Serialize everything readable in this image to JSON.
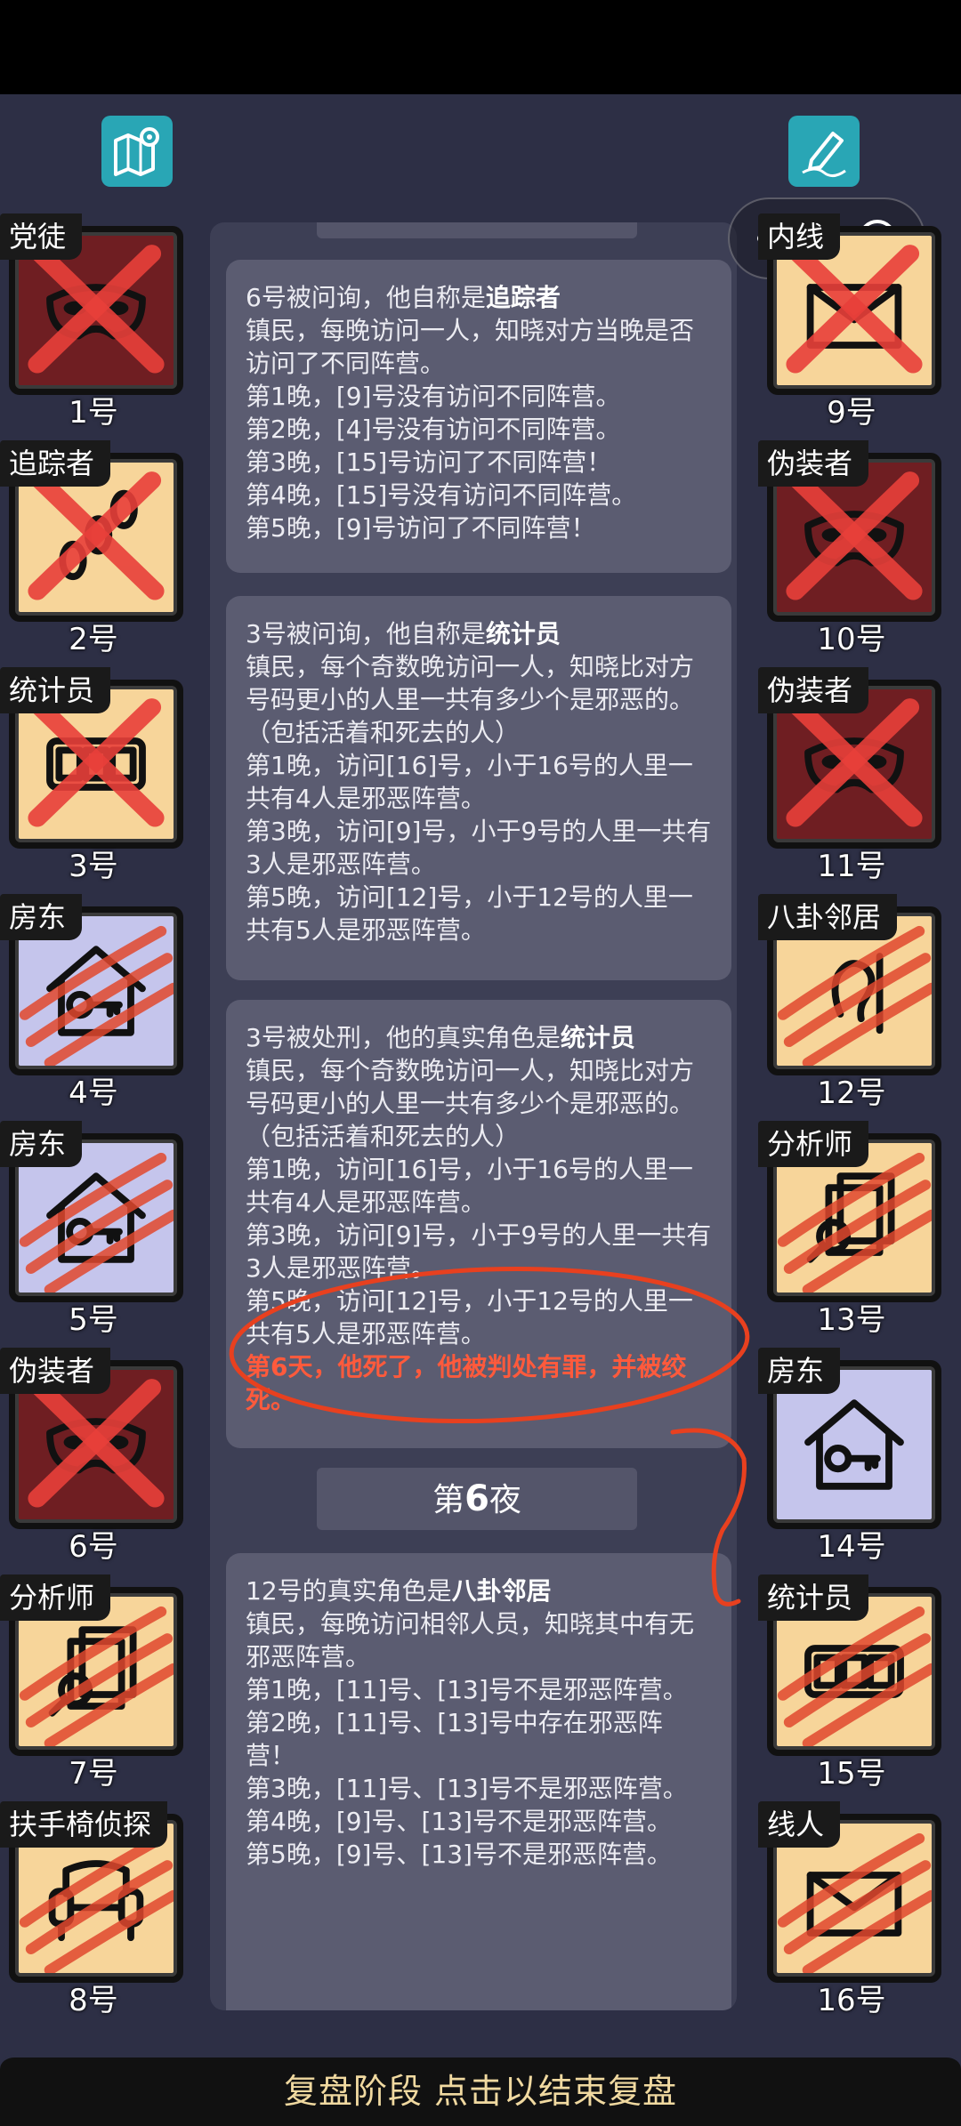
{
  "toolbar": {
    "map_icon": "map-pin-icon",
    "note_icon": "pen-note-icon"
  },
  "players_left": [
    {
      "role": "党徒",
      "seat": "1号",
      "bg": "evil",
      "mark": "x",
      "icon": "mask-icon"
    },
    {
      "role": "追踪者",
      "seat": "2号",
      "bg": "good",
      "mark": "x",
      "icon": "footprints-icon"
    },
    {
      "role": "统计员",
      "seat": "3号",
      "bg": "good",
      "mark": "x",
      "icon": "counter-icon"
    },
    {
      "role": "房东",
      "seat": "4号",
      "bg": "lav",
      "mark": "claw",
      "icon": "house-key-icon"
    },
    {
      "role": "房东",
      "seat": "5号",
      "bg": "lav",
      "mark": "claw",
      "icon": "house-key-icon"
    },
    {
      "role": "伪装者",
      "seat": "6号",
      "bg": "evil",
      "mark": "x",
      "icon": "mask-icon"
    },
    {
      "role": "分析师",
      "seat": "7号",
      "bg": "good",
      "mark": "claw",
      "icon": "files-magnifier-icon"
    },
    {
      "role": "扶手椅侦探",
      "seat": "8号",
      "bg": "good",
      "mark": "claw",
      "icon": "armchair-icon"
    }
  ],
  "players_right": [
    {
      "role": "内线",
      "seat": "9号",
      "bg": "good",
      "mark": "x",
      "icon": "envelope-icon"
    },
    {
      "role": "伪装者",
      "seat": "10号",
      "bg": "evil",
      "mark": "x",
      "icon": "mask-icon"
    },
    {
      "role": "伪装者",
      "seat": "11号",
      "bg": "evil",
      "mark": "x",
      "icon": "mask-icon"
    },
    {
      "role": "八卦邻居",
      "seat": "12号",
      "bg": "good",
      "mark": "claw",
      "icon": "ear-icon"
    },
    {
      "role": "分析师",
      "seat": "13号",
      "bg": "good",
      "mark": "claw",
      "icon": "files-magnifier-icon"
    },
    {
      "role": "房东",
      "seat": "14号",
      "bg": "lav",
      "mark": "none",
      "icon": "house-key-icon"
    },
    {
      "role": "统计员",
      "seat": "15号",
      "bg": "good",
      "mark": "claw",
      "icon": "counter-icon"
    },
    {
      "role": "线人",
      "seat": "16号",
      "bg": "good",
      "mark": "claw",
      "icon": "envelope-icon"
    }
  ],
  "log": {
    "m1": {
      "intro": "6号被问询，他自称是",
      "role": "追踪者",
      "lines": [
        "镇民，每晚访问一人，知晓对方当晚是否访问了不同阵营。",
        "第1晚，[9]号没有访问不同阵营。",
        "第2晚，[4]号没有访问不同阵营。",
        "第3晚，[15]号访问了不同阵营！",
        "第4晚，[15]号没有访问不同阵营。",
        "第5晚，[9]号访问了不同阵营！"
      ]
    },
    "m2": {
      "intro": "3号被问询，他自称是",
      "role": "统计员",
      "lines": [
        "镇民，每个奇数晚访问一人，知晓比对方号码更小的人里一共有多少个是邪恶的。（包括活着和死去的人）",
        "第1晚，访问[16]号，小于16号的人里一共有4人是邪恶阵营。",
        "第3晚，访问[9]号，小于9号的人里一共有3人是邪恶阵营。",
        "第5晚，访问[12]号，小于12号的人里一共有5人是邪恶阵营。"
      ]
    },
    "m3": {
      "intro": "3号被处刑，他的真实角色是",
      "role": "统计员",
      "lines": [
        "镇民，每个奇数晚访问一人，知晓比对方号码更小的人里一共有多少个是邪恶的。（包括活着和死去的人）",
        "第1晚，访问[16]号，小于16号的人里一共有4人是邪恶阵营。",
        "第3晚，访问[9]号，小于9号的人里一共有3人是邪恶阵营。",
        "第5晚，访问[12]号，小于12号的人里一共有5人是邪恶阵营。"
      ],
      "death": "第6天，他死了，他被判处有罪，并被绞死。"
    },
    "night_prefix": "第",
    "night_num": "6",
    "night_suffix": "夜",
    "m4": {
      "intro": "12号的真实角色是",
      "role": "八卦邻居",
      "lines": [
        "镇民，每晚访问相邻人员，知晓其中有无邪恶阵营。",
        "第1晚，[11]号、[13]号不是邪恶阵营。",
        "第2晚，[11]号、[13]号中存在邪恶阵营！",
        "第3晚，[11]号、[13]号不是邪恶阵营。",
        "第4晚，[9]号、[13]号不是邪恶阵营。",
        "第5晚，[9]号、[13]号不是邪恶阵营。"
      ]
    }
  },
  "bottom_bar": "复盘阶段 点击以结束复盘",
  "colors": {
    "good_bg": "#f7d59a",
    "evil_bg": "#6f1e22",
    "lavender_bg": "#c5c5ec",
    "annotation": "#e8401f"
  }
}
